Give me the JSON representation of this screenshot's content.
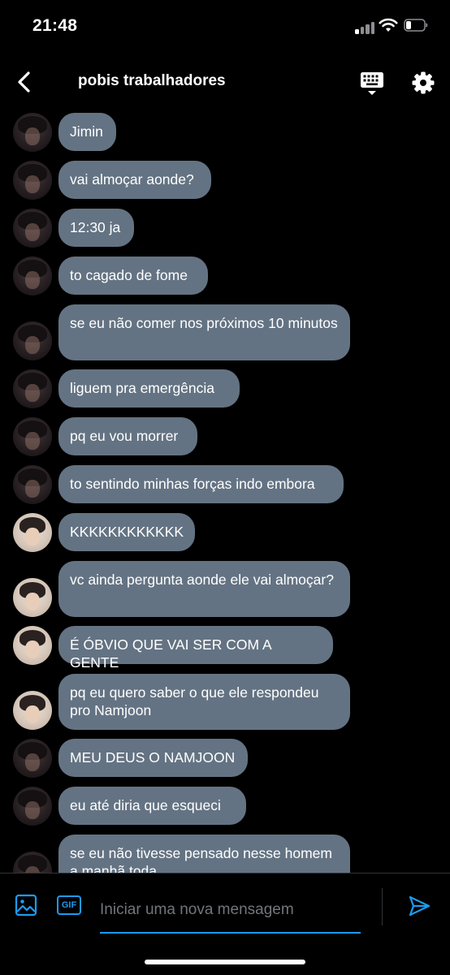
{
  "status": {
    "time": "21:48"
  },
  "header": {
    "title": "pobis trabalhadores"
  },
  "messages": [
    {
      "text": "Jimin",
      "avatar": "dark"
    },
    {
      "text": "vai almoçar aonde?",
      "avatar": "dark"
    },
    {
      "text": "12:30 ja",
      "avatar": "dark"
    },
    {
      "text": "to cagado de fome",
      "avatar": "dark"
    },
    {
      "text": "se eu não comer nos próximos 10 minutos",
      "avatar": "dark"
    },
    {
      "text": "liguem pra emergência",
      "avatar": "dark"
    },
    {
      "text": "pq eu vou morrer",
      "avatar": "dark"
    },
    {
      "text": "to sentindo minhas forças indo embora",
      "avatar": "dark"
    },
    {
      "text": "KKKKKKKKKKKK",
      "avatar": "light"
    },
    {
      "text": "vc ainda pergunta aonde ele vai almoçar?",
      "avatar": "light"
    },
    {
      "text": "É ÓBVIO QUE VAI SER COM A GENTE",
      "avatar": "light"
    },
    {
      "text": "pq eu quero saber o que ele respondeu pro Namjoon",
      "avatar": "light"
    },
    {
      "text": "MEU DEUS O NAMJOON",
      "avatar": "dark"
    },
    {
      "text": "eu até diria que esqueci",
      "avatar": "dark"
    },
    {
      "text": "se eu não tivesse pensado nesse homem a manhã toda",
      "avatar": "dark"
    }
  ],
  "composer": {
    "placeholder": "Iniciar uma nova mensagem",
    "gif_label": "GIF"
  },
  "colors": {
    "bubble": "#647383",
    "accent": "#1d9bf0",
    "background": "#000000"
  }
}
